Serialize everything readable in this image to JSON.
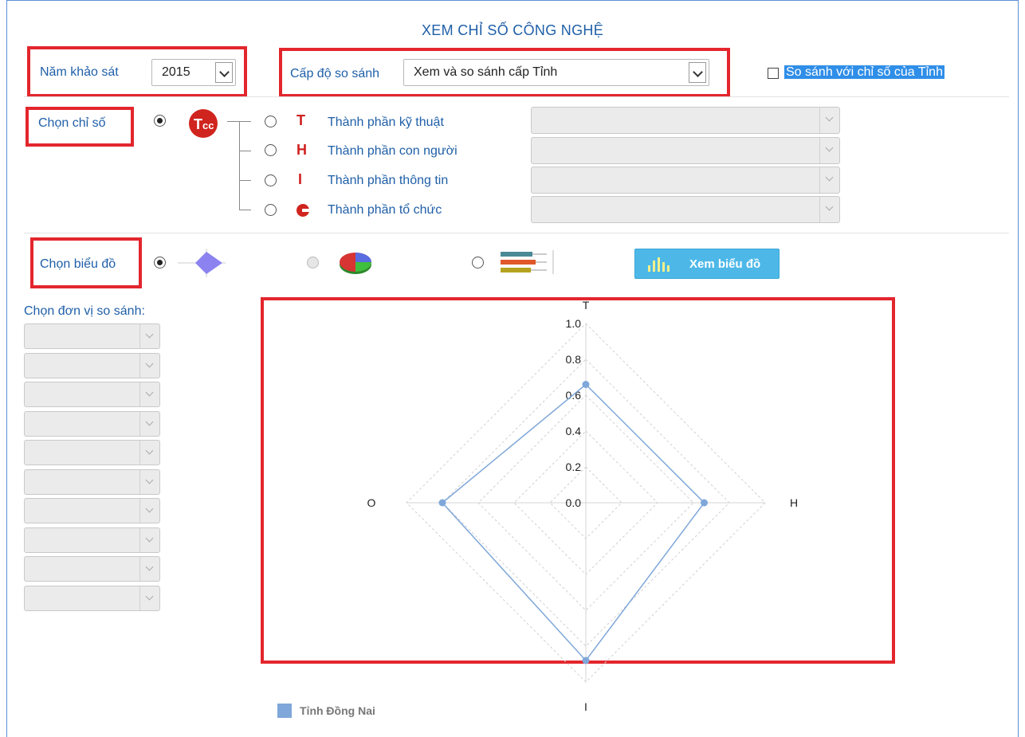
{
  "title": "XEM CHỈ SỐ CÔNG NGHỆ",
  "survey_year": {
    "label": "Năm khảo sát",
    "value": "2015"
  },
  "compare_level": {
    "label": "Cấp độ so sánh",
    "value": "Xem và so sánh cấp Tỉnh"
  },
  "compare_province": {
    "label": "So sánh với chỉ số của Tỉnh",
    "checked": false
  },
  "index_select": {
    "label": "Chọn chỉ số",
    "items": [
      {
        "label": "Thành phần kỹ thuật",
        "icon": "technique-icon"
      },
      {
        "label": "Thành phần con người",
        "icon": "human-icon"
      },
      {
        "label": "Thành phần thông tin",
        "icon": "information-icon"
      },
      {
        "label": "Thành phần tổ chức",
        "icon": "organization-icon"
      }
    ]
  },
  "chart_select": {
    "label": "Chọn biểu đồ",
    "options": [
      "radar",
      "pie",
      "bar"
    ],
    "button_label": "Xem biểu đồ"
  },
  "unit_select": {
    "label": "Chọn đơn vị so sánh:",
    "count": 10
  },
  "colors": {
    "accent": "#1f5fa8",
    "highlight": "#e3262d",
    "series": "#7fa7d9",
    "button": "#4db8e8"
  },
  "chart_data": {
    "type": "radar",
    "axes": [
      "T",
      "H",
      "I",
      "O"
    ],
    "ticks": [
      "0.0",
      "0.2",
      "0.4",
      "0.6",
      "0.8",
      "1.0"
    ],
    "range": [
      0,
      1
    ],
    "series": [
      {
        "name": "Tỉnh Đồng Nai",
        "values": [
          0.66,
          0.66,
          0.88,
          0.8
        ]
      }
    ],
    "grid": true,
    "legend": "bottom-left"
  }
}
